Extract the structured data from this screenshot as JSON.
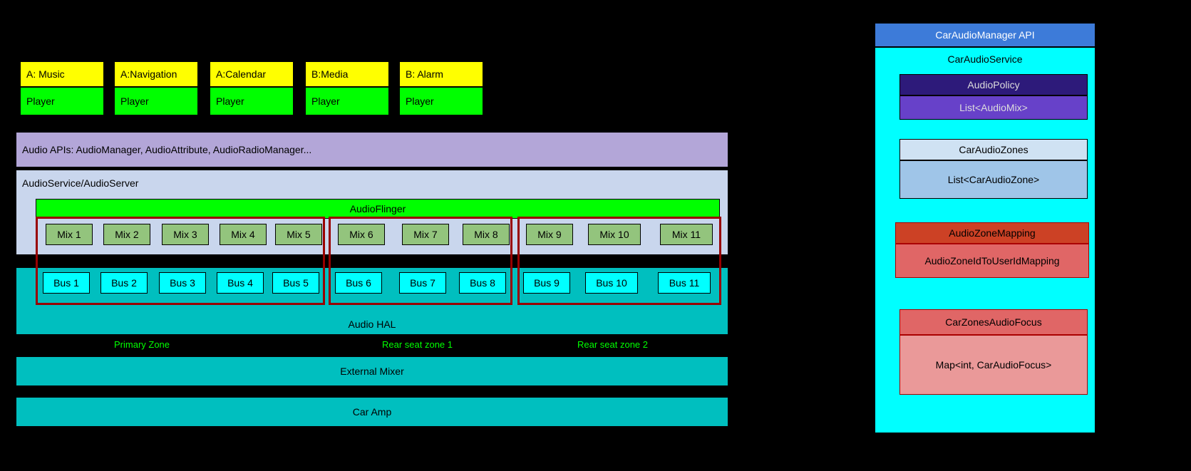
{
  "apps": [
    {
      "top": "A: Music",
      "bottom": "Player"
    },
    {
      "top": "A:Navigation",
      "bottom": "Player"
    },
    {
      "top": "A:Calendar",
      "bottom": "Player"
    },
    {
      "top": "B:Media",
      "bottom": "Player"
    },
    {
      "top": "B: Alarm",
      "bottom": "Player"
    }
  ],
  "apis": "Audio APIs: AudioManager, AudioAttribute, AudioRadioManager...",
  "audioservice": "AudioService/AudioServer",
  "flinger": "AudioFlinger",
  "mixes": [
    "Mix 1",
    "Mix 2",
    "Mix 3",
    "Mix 4",
    "Mix 5",
    "Mix 6",
    "Mix 7",
    "Mix 8",
    "Mix 9",
    "Mix 10",
    "Mix 11"
  ],
  "buses": [
    "Bus 1",
    "Bus 2",
    "Bus 3",
    "Bus 4",
    "Bus 5",
    "Bus 6",
    "Bus 7",
    "Bus 8",
    "Bus 9",
    "Bus 10",
    "Bus 11"
  ],
  "hal": "Audio HAL",
  "mixer": "External Mixer",
  "amp": "Car Amp",
  "zone_labels": [
    "Primary Zone",
    "Rear seat zone 1",
    "Rear seat zone 2"
  ],
  "right": {
    "api": "CarAudioManager API",
    "service": "CarAudioService",
    "policy_top": "AudioPolicy",
    "policy_bottom": "List<AudioMix>",
    "zones_top": "CarAudioZones",
    "zones_bottom": "List<CarAudioZone>",
    "mapping_top": "AudioZoneMapping",
    "mapping_bottom": "AudioZoneIdToUserIdMapping",
    "focus_top": "CarZonesAudioFocus",
    "focus_bottom": "Map<int, CarAudioFocus>"
  }
}
